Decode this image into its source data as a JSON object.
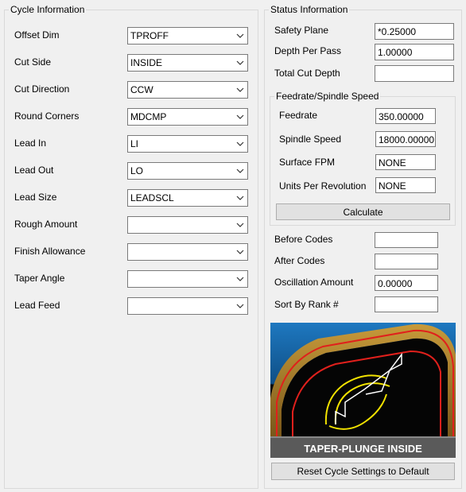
{
  "cycle_info": {
    "title": "Cycle Information",
    "fields": [
      {
        "label": "Offset Dim",
        "value": "TPROFF"
      },
      {
        "label": "Cut Side",
        "value": "INSIDE"
      },
      {
        "label": "Cut Direction",
        "value": "CCW"
      },
      {
        "label": "Round Corners",
        "value": "MDCMP"
      },
      {
        "label": "Lead In",
        "value": "LI"
      },
      {
        "label": "Lead Out",
        "value": "LO"
      },
      {
        "label": "Lead Size",
        "value": "LEADSCL"
      },
      {
        "label": "Rough Amount",
        "value": ""
      },
      {
        "label": "Finish Allowance",
        "value": ""
      },
      {
        "label": "Taper Angle",
        "value": ""
      },
      {
        "label": "Lead Feed",
        "value": ""
      }
    ]
  },
  "status_info": {
    "title": "Status Information",
    "safety_plane": {
      "label": "Safety Plane",
      "value": "*0.25000"
    },
    "depth_per_pass": {
      "label": "Depth Per Pass",
      "value": "1.00000"
    },
    "total_cut_depth": {
      "label": "Total Cut Depth",
      "value": ""
    },
    "feed_group": {
      "title": "Feedrate/Spindle Speed",
      "feedrate": {
        "label": "Feedrate",
        "value": "350.00000"
      },
      "spindle_speed": {
        "label": "Spindle Speed",
        "value": "18000.00000"
      },
      "surface_fpm": {
        "label": "Surface FPM",
        "value": "NONE"
      },
      "units_per_rev": {
        "label": "Units Per Revolution",
        "value": "NONE"
      },
      "calculate_label": "Calculate"
    },
    "before_codes": {
      "label": "Before Codes",
      "value": ""
    },
    "after_codes": {
      "label": "After Codes",
      "value": ""
    },
    "oscillation_amount": {
      "label": "Oscillation Amount",
      "value": "0.00000"
    },
    "sort_by_rank": {
      "label": "Sort By Rank #",
      "value": ""
    },
    "picture_caption": "TAPER-PLUNGE INSIDE",
    "reset_label": "Reset Cycle Settings to Default"
  },
  "colors": {
    "picture_bg_top": "#1a6fb8",
    "picture_bg_bottom": "#0b0b0b",
    "material_gold": "#a0782a",
    "toolpath_red": "#e0201c",
    "lead_yellow": "#f2e200"
  }
}
